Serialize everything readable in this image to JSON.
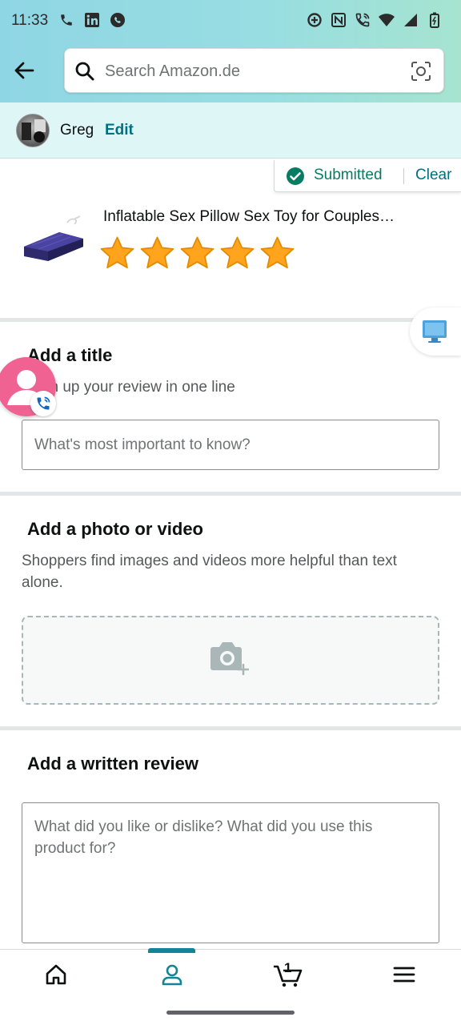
{
  "status_bar": {
    "time": "11:33"
  },
  "search": {
    "placeholder": "Search Amazon.de"
  },
  "user": {
    "name": "Greg",
    "edit_label": "Edit"
  },
  "submission": {
    "status_label": "Submitted",
    "clear_label": "Clear"
  },
  "product": {
    "title": "Inflatable Sex Pillow Sex Toy for Couples…",
    "rating": 5,
    "rating_max": 5
  },
  "title_section": {
    "heading": "Add a title",
    "subtext": "Sum up your review in one line",
    "placeholder": "What's most important to know?"
  },
  "photo_section": {
    "heading": "Add a photo or video",
    "subtext": "Shoppers find images and videos more helpful than text alone."
  },
  "review_section": {
    "heading": "Add a written review",
    "placeholder": "What did you like or dislike? What did you use this product for?"
  },
  "bottom_nav": {
    "cart_count": "1",
    "active_tab": "account"
  },
  "colors": {
    "accent": "#007185",
    "success": "#067d62",
    "star": "#ffa41c",
    "nav_indicator": "#138496"
  }
}
